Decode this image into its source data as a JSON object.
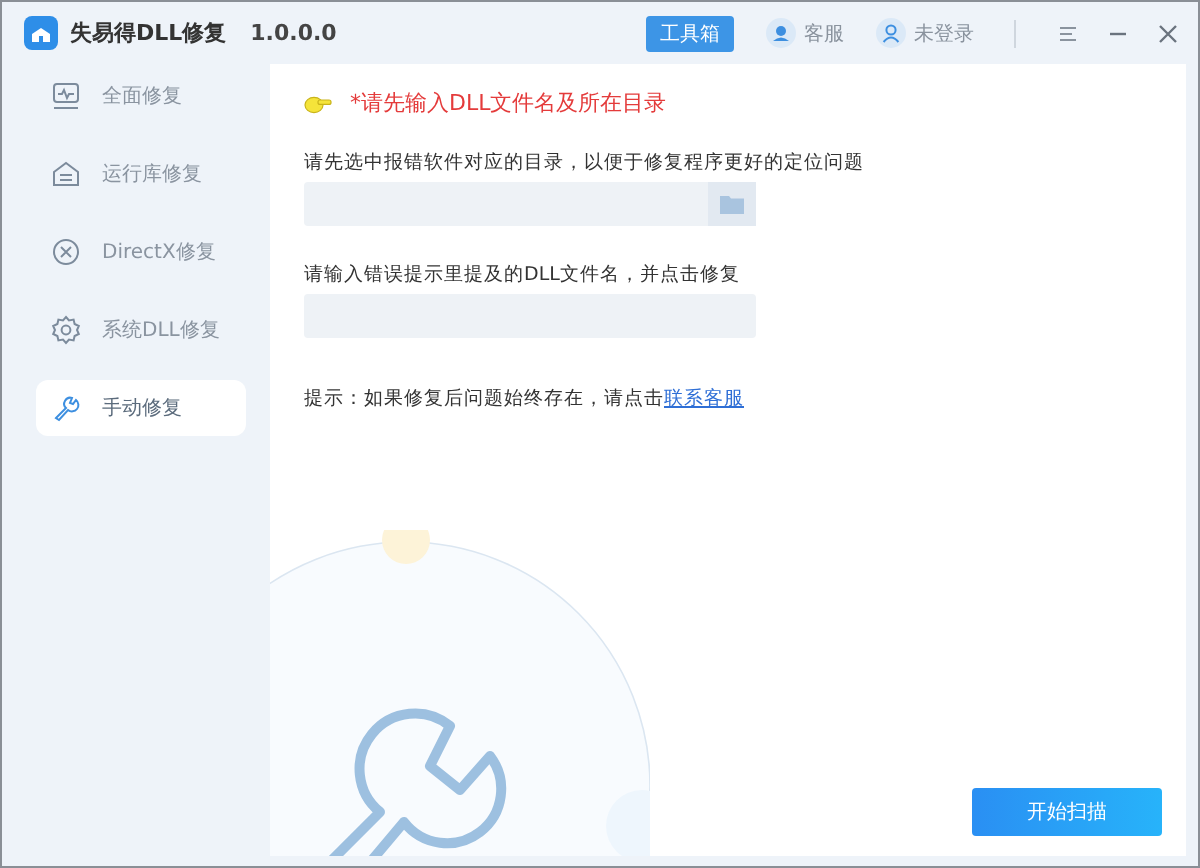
{
  "window": {
    "app_name": "失易得DLL修复",
    "version": "1.0.0.0"
  },
  "header_actions": {
    "toolbox": "工具箱",
    "support": "客服",
    "login": "未登录"
  },
  "sidebar": {
    "items": [
      {
        "label": "全面修复",
        "selected": false
      },
      {
        "label": "运行库修复",
        "selected": false
      },
      {
        "label": "DirectX修复",
        "selected": false
      },
      {
        "label": "系统DLL修复",
        "selected": false
      },
      {
        "label": "手动修复",
        "selected": true
      }
    ]
  },
  "main": {
    "heading": "*请先输入DLL文件名及所在目录",
    "directory_label": "请先选中报错软件对应的目录，以便于修复程序更好的定位问题",
    "filename_label": "请输入错误提示里提及的DLL文件名，并点击修复",
    "hint": {
      "text": "提示：如果修复后问题始终存在，请点击",
      "link": "联系客服"
    },
    "start_button": "开始扫描"
  }
}
